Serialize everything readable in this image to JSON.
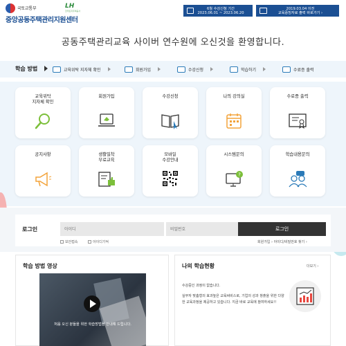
{
  "header": {
    "ministry": "국토교통부",
    "lh": "LH",
    "lh_sub": "한국토지주택공사",
    "site_name": "중앙공동주택관리지원센터",
    "notices": [
      {
        "line1": "6월 수강신청 기간",
        "line2": "2023.06.01 ~ 2023.06.20"
      },
      {
        "line1": "2019.03.04 이전",
        "line2": "교육증빙자료 출력 바로가기 ›"
      }
    ]
  },
  "hero": {
    "title": "공동주택관리교육 사이버 연수원에 오신것을 환영합니다."
  },
  "steps": {
    "title": "학습 방법",
    "items": [
      {
        "label": "교육위탁 지자체 확인",
        "icon": "search-icon"
      },
      {
        "label": "회원가입",
        "icon": "monitor-icon"
      },
      {
        "label": "수강신청",
        "icon": "book-icon"
      },
      {
        "label": "학습하기",
        "icon": "calendar-icon"
      },
      {
        "label": "수료증 출력",
        "icon": "certificate-icon"
      }
    ]
  },
  "tiles": [
    {
      "label": "교육위탁\n지자체 확인",
      "icon": "magnifier-icon"
    },
    {
      "label": "회원가입",
      "icon": "laptop-icon"
    },
    {
      "label": "수강신청",
      "icon": "book-click-icon"
    },
    {
      "label": "나의 강의실",
      "icon": "calendar-icon"
    },
    {
      "label": "수료증 출력",
      "icon": "certificate-icon"
    },
    {
      "label": "공지사항",
      "icon": "megaphone-icon"
    },
    {
      "label": "생활밀착\n무료교육",
      "icon": "book-thumb-icon"
    },
    {
      "label": "모바일\n수강안내",
      "icon": "qr-code-icon"
    },
    {
      "label": "시스템문의",
      "icon": "computer-help-icon"
    },
    {
      "label": "학습내용문의",
      "icon": "users-chat-icon"
    }
  ],
  "login": {
    "title": "로그인",
    "id_placeholder": "아이디",
    "pw_placeholder": "비밀번호",
    "button": "로그인",
    "keep_login": "보안접속",
    "remember_id": "아이디기억",
    "links": "회원가입 › 아이디/비밀번호 찾기 ›"
  },
  "video_panel": {
    "title": "학습 방법 영상",
    "caption": "처음 오신 분들을 위한 학습방법을 안내해 드립니다."
  },
  "status_panel": {
    "title": "나의 학습현황",
    "more": "더보기 ›",
    "line1": "수강중인 과정이 없습니다.",
    "body": "실무자 맞춤형의 효과높은 교육써비스로, 기업의 성과 창출을 위한 다양한 교육과정을 제공하고 있습니다. 지금 바로 교육에 참여하세요!!"
  },
  "colors": {
    "brand_blue": "#1b4f93",
    "accent_orange": "#f3a33a",
    "accent_green": "#7cbf3a",
    "bg_light_blue": "#eef5fb"
  }
}
